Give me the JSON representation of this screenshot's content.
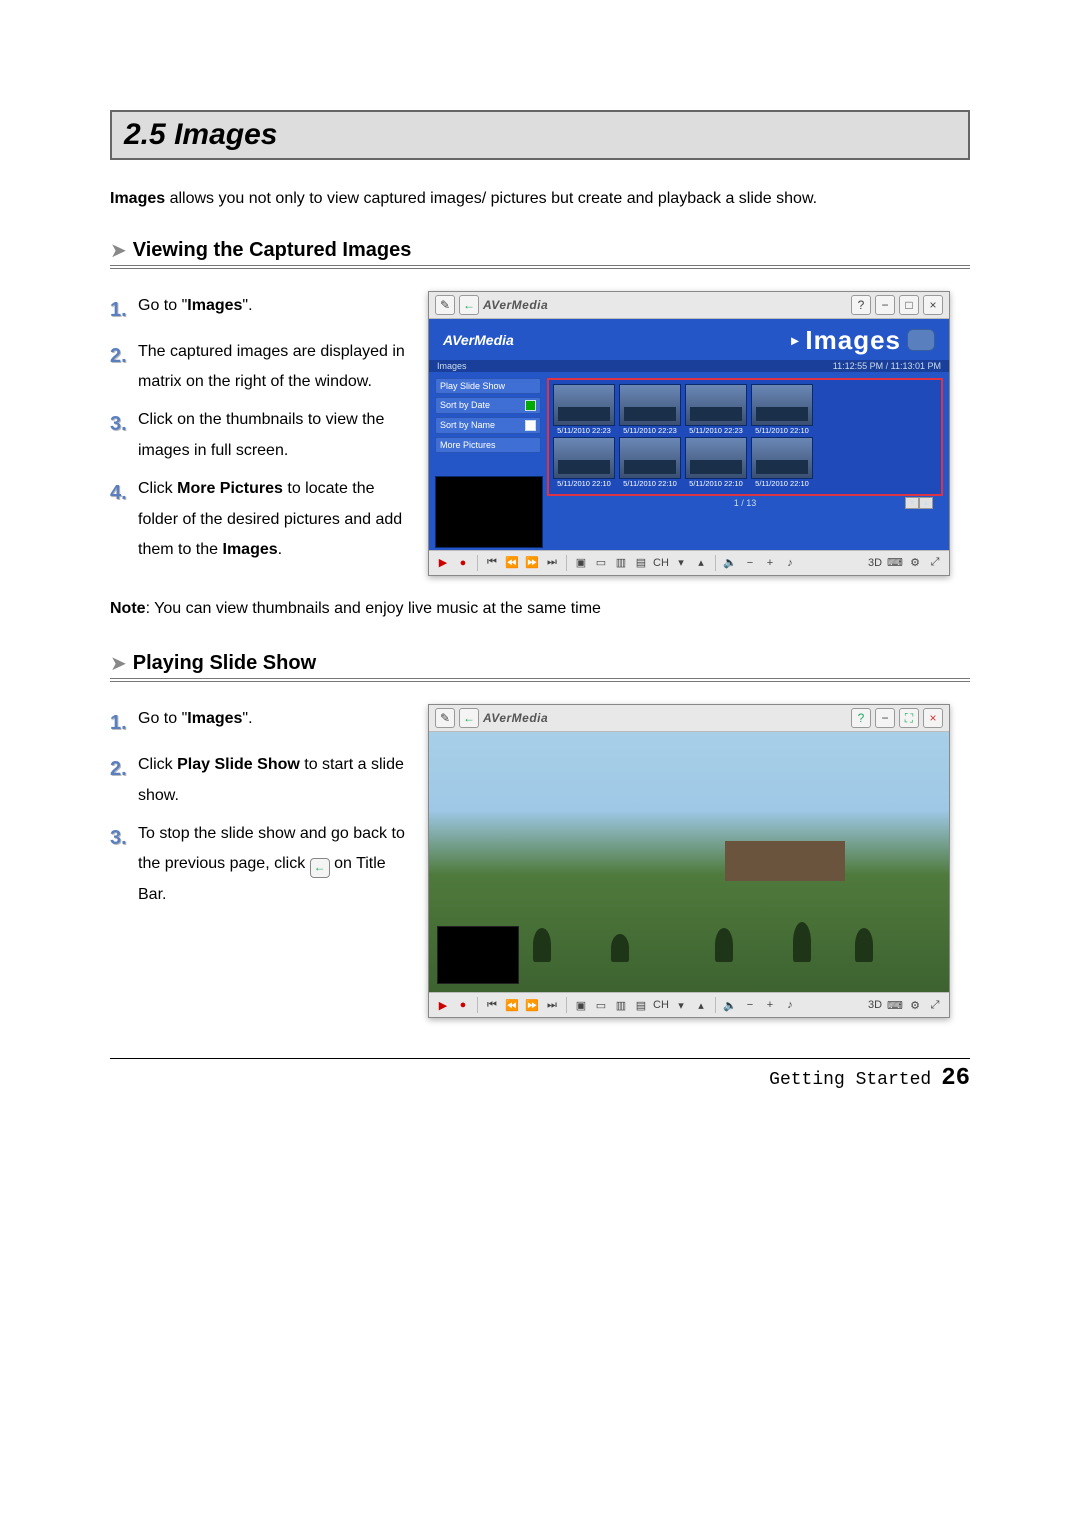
{
  "section": {
    "number": "2.5",
    "title": "Images"
  },
  "intro_prefix": "Images",
  "intro_rest": " allows you not only to view captured images/ pictures but create and playback a slide show.",
  "sub1": "Viewing the Captured Images",
  "steps1": {
    "s1a": "Go to \"",
    "s1b": "Images",
    "s1c": "\".",
    "s2": "The captured images are displayed in matrix on the right of the window.",
    "s3": "Click on the thumbnails to view the images in full screen.",
    "s4a": "Click ",
    "s4b": "More Pictures",
    "s4c": " to locate the folder of the desired pictures and add them to the ",
    "s4d": "Images",
    "s4e": "."
  },
  "note_prefix": "Note",
  "note_rest": ": You can view thumbnails and enjoy live music at the same time",
  "sub2": "Playing Slide Show",
  "steps2": {
    "s1a": "Go to \"",
    "s1b": "Images",
    "s1c": "\".",
    "s2a": "Click ",
    "s2b": "Play Slide Show",
    "s2c": " to start a slide show.",
    "s3a": "To stop the slide show and go back to the previous page, click ",
    "s3b": " on Title Bar."
  },
  "app": {
    "brand": "AVerMedia",
    "title": "Images",
    "crumb": "Images",
    "clock": "11:12:55 PM / 11:13:01 PM",
    "side": {
      "play": "Play Slide Show",
      "sort_date": "Sort by Date",
      "sort_name": "Sort by Name",
      "more": "More Pictures"
    },
    "thumbs": [
      "5/11/2010 22:23",
      "5/11/2010 22:23",
      "5/11/2010 22:23",
      "5/11/2010 22:10",
      "5/11/2010 22:10",
      "5/11/2010 22:10",
      "5/11/2010 22:10",
      "5/11/2010 22:10"
    ],
    "pager": "1 / 13",
    "ctrl": {
      "ch": "CH",
      "threeD": "3D"
    }
  },
  "footer": {
    "label": "Getting Started",
    "page": "26"
  }
}
